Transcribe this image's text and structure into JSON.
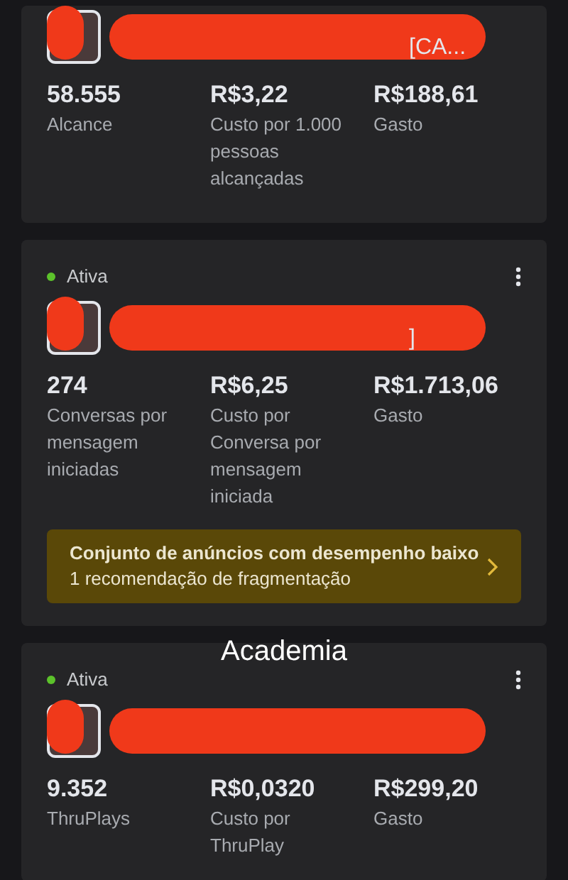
{
  "overlay_caption": "Academia",
  "cards": [
    {
      "name_tail": "[CA...",
      "metrics": [
        {
          "value": "58.555",
          "label": "Alcance"
        },
        {
          "value": "R$3,22",
          "label": "Custo por 1.000 pessoas alcançadas"
        },
        {
          "value": "R$188,61",
          "label": "Gasto"
        }
      ]
    },
    {
      "status": "Ativa",
      "name_tail": "]",
      "metrics": [
        {
          "value": "274",
          "label": "Conversas por mensagem iniciadas"
        },
        {
          "value": "R$6,25",
          "label": "Custo por Conversa por mensagem iniciada"
        },
        {
          "value": "R$1.713,06",
          "label": "Gasto"
        }
      ],
      "alert": {
        "title": "Conjunto de anúncios com desempenho baixo",
        "subtitle": "1 recomendação de fragmentação"
      }
    },
    {
      "status": "Ativa",
      "metrics": [
        {
          "value": "9.352",
          "label": "ThruPlays"
        },
        {
          "value": "R$0,0320",
          "label": "Custo por ThruPlay"
        },
        {
          "value": "R$299,20",
          "label": "Gasto"
        }
      ]
    }
  ]
}
